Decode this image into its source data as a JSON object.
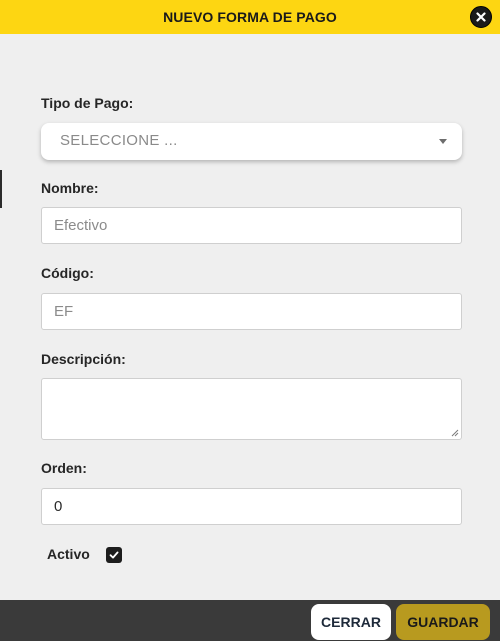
{
  "header": {
    "title": "NUEVO FORMA DE PAGO",
    "close_icon": "close-icon"
  },
  "form": {
    "tipo_pago": {
      "label": "Tipo de Pago:",
      "selected": "SELECCIONE ..."
    },
    "nombre": {
      "label": "Nombre:",
      "placeholder": "Efectivo",
      "value": ""
    },
    "codigo": {
      "label": "Código:",
      "placeholder": "EF",
      "value": ""
    },
    "descripcion": {
      "label": "Descripción:",
      "value": ""
    },
    "orden": {
      "label": "Orden:",
      "value": "0"
    },
    "activo": {
      "label": "Activo",
      "checked": true
    }
  },
  "footer": {
    "cerrar_label": "CERRAR",
    "guardar_label": "GUARDAR"
  },
  "colors": {
    "header_bg": "#fdd612",
    "footer_bg": "#3a3a3a",
    "guardar_bg": "#b89a1f",
    "body_bg": "#efefef"
  }
}
